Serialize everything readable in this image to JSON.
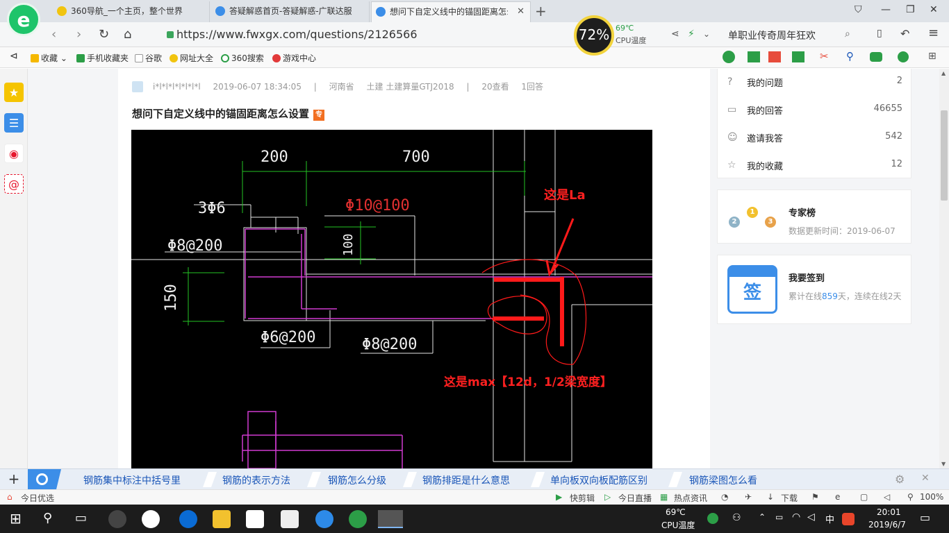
{
  "browser": {
    "tabs": [
      {
        "title": "360导航_一个主页，整个世界"
      },
      {
        "title": "答疑解惑首页-答疑解惑-广联达服"
      },
      {
        "title": "想问下自定义线中的锚固距离怎么"
      }
    ],
    "url": "https://www.fwxgx.com/questions/2126566",
    "cpu_percent": "72%",
    "cpu_temp": "69℃",
    "cpu_label": "CPU温度",
    "search_text": "单职业传奇周年狂欢",
    "bookmarks": [
      "收藏",
      "手机收藏夹",
      "谷歌",
      "网址大全",
      "360搜索",
      "游戏中心"
    ]
  },
  "question": {
    "author": "i*l*l*l*l*l*l*l",
    "date": "2019-06-07 18:34:05",
    "region": "河南省",
    "tags": "土建  土建算量GTJ2018",
    "views": "20查看",
    "answers": "1回答",
    "title": "想问下自定义线中的锚固距离怎么设置",
    "tag_badge": "专"
  },
  "cad_image": {
    "dims": [
      "200",
      "700",
      "3Φ6",
      "Φ10@100",
      "Φ8@200",
      "100",
      "150",
      "Φ6@200",
      "Φ8@200"
    ],
    "annotation_la": "这是La",
    "annotation_max": "这是max【12d，1/2梁宽度】"
  },
  "sidebar": {
    "stats": [
      {
        "label": "我的问题",
        "value": "2"
      },
      {
        "label": "我的回答",
        "value": "46655"
      },
      {
        "label": "邀请我答",
        "value": "542"
      },
      {
        "label": "我的收藏",
        "value": "12"
      }
    ],
    "experts": {
      "title": "专家榜",
      "subtitle": "数据更新时间：2019-06-07"
    },
    "signin": {
      "title": "我要签到",
      "icon_text": "签",
      "prefix": "累计在线",
      "days": "859",
      "suffix": "天，连续在线2天"
    }
  },
  "hotbar": {
    "items": [
      "钢筋集中标注中括号里",
      "钢筋的表示方法",
      "钢筋怎么分级",
      "钢筋排距是什么意思",
      "单向板双向板配筋区别",
      "钢筋梁图怎么看"
    ]
  },
  "statusbar": {
    "left": "今日优选",
    "items": [
      "快剪辑",
      "今日直播",
      "热点资讯",
      "下载",
      "100%"
    ]
  },
  "taskbar": {
    "cpu_temp": "69℃",
    "cpu_label": "CPU温度",
    "ime": "中",
    "time": "20:01",
    "date": "2019/6/7"
  },
  "colors": {
    "accent": "#3c8ee8",
    "annotation": "#ff2020",
    "link": "#1a56b8"
  }
}
